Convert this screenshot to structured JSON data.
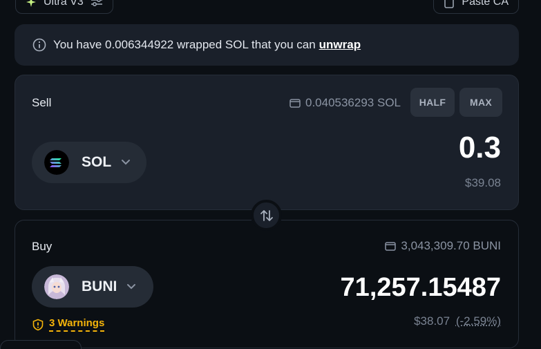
{
  "top": {
    "left_chip_label": "Ultra V3",
    "right_chip_label": "Paste CA"
  },
  "notice": {
    "text": "You have 0.006344922 wrapped SOL that you can",
    "link": "unwrap"
  },
  "sell": {
    "label": "Sell",
    "balance": "0.040536293 SOL",
    "half_label": "HALF",
    "max_label": "MAX",
    "token": "SOL",
    "amount": "0.3",
    "usd_value": "$39.08"
  },
  "buy": {
    "label": "Buy",
    "balance": "3,043,309.70 BUNI",
    "token": "BUNI",
    "amount": "71,257.15487",
    "usd_value": "$38.07",
    "price_impact": "(-2.59%)",
    "warnings": "3 Warnings"
  },
  "colors": {
    "background": "#0b0f14",
    "card": "#1a202a",
    "warning": "#f5b40a",
    "muted_text": "#8b94a3"
  },
  "icons": [
    "sparkle-icon",
    "settings-sliders-icon",
    "clipboard-icon",
    "info-icon",
    "wallet-icon",
    "chevron-down-icon",
    "swap-arrows-icon",
    "warning-shield-icon"
  ]
}
